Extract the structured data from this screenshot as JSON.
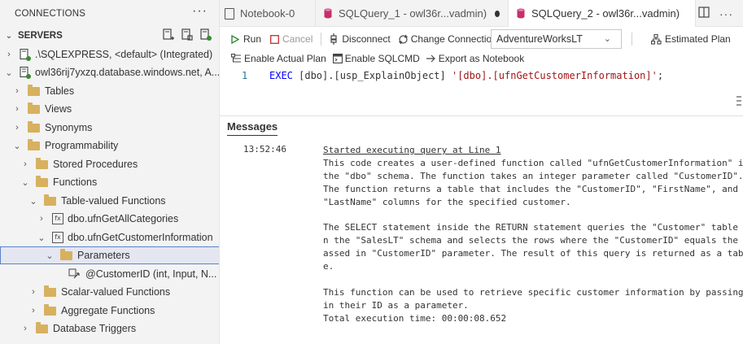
{
  "sidebar": {
    "header": "CONNECTIONS",
    "more": "···",
    "servers_label": "SERVERS",
    "tree": [
      {
        "label": ".\\SQLEXPRESS, <default> (Integrated)"
      },
      {
        "label": "owl36rij7yxzq.database.windows.net, A..."
      },
      {
        "label": "Tables"
      },
      {
        "label": "Views"
      },
      {
        "label": "Synonyms"
      },
      {
        "label": "Programmability"
      },
      {
        "label": "Stored Procedures"
      },
      {
        "label": "Functions"
      },
      {
        "label": "Table-valued Functions"
      },
      {
        "label": "dbo.ufnGetAllCategories"
      },
      {
        "label": "dbo.ufnGetCustomerInformation"
      },
      {
        "label": "Parameters"
      },
      {
        "label": "@CustomerID (int, Input, N..."
      },
      {
        "label": "Scalar-valued Functions"
      },
      {
        "label": "Aggregate Functions"
      },
      {
        "label": "Database Triggers"
      }
    ]
  },
  "tabs": [
    {
      "label": "Notebook-0"
    },
    {
      "label": "SQLQuery_1 - owl36r...vadmin)"
    },
    {
      "label": "SQLQuery_2 - owl36r...vadmin)"
    }
  ],
  "toolbar": {
    "run": "Run",
    "cancel": "Cancel",
    "disconnect": "Disconnect",
    "change_connection": "Change Connection",
    "database": "AdventureWorksLT",
    "estimated_plan": "Estimated Plan",
    "enable_actual_plan": "Enable Actual Plan",
    "enable_sqlcmd": "Enable SQLCMD",
    "export_notebook": "Export as Notebook"
  },
  "editor": {
    "line_number": "1",
    "code_exec": "EXEC",
    "code_obj": " [dbo].[usp_ExplainObject] ",
    "code_str": "'[dbo].[ufnGetCustomerInformation]'",
    "code_end": ";"
  },
  "messages": {
    "title": "Messages",
    "time": "13:52:46",
    "started": "Started executing query at Line 1",
    "body": "This code creates a user-defined function called \"ufnGetCustomerInformation\" in\nthe \"dbo\" schema. The function takes an integer parameter called \"CustomerID\".\nThe function returns a table that includes the \"CustomerID\", \"FirstName\", and\n\"LastName\" columns for the specified customer.\n\nThe SELECT statement inside the RETURN statement queries the \"Customer\" table i\nn the \"SalesLT\" schema and selects the rows where the \"CustomerID\" equals the p\nassed in \"CustomerID\" parameter. The result of this query is returned as a tabl\ne.\n\nThis function can be used to retrieve specific customer information by passing\nin their ID as a parameter.\nTotal execution time: 00:00:08.652"
  },
  "colors": {
    "accent": "#5b83c9",
    "run_green": "#388a34",
    "cancel_red": "#c72e2e",
    "tab_db_icon": "#c72e6b",
    "folder": "#d7b15f"
  }
}
